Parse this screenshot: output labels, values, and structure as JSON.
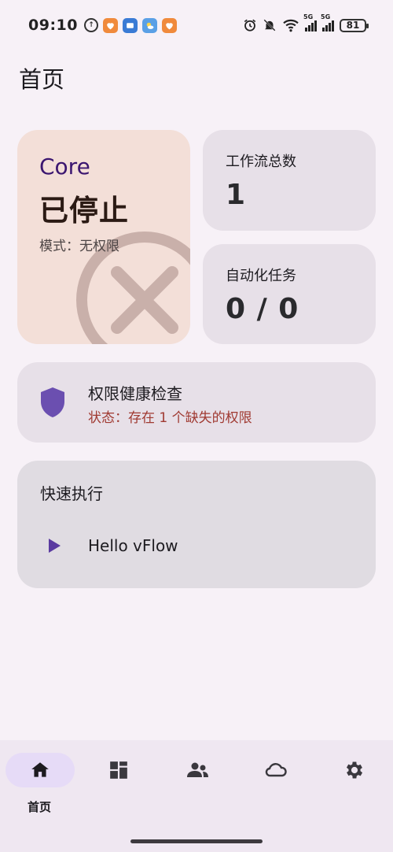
{
  "status_bar": {
    "time": "09:10",
    "signal_1_label": "5G",
    "signal_2_label": "5G",
    "battery": "81"
  },
  "page": {
    "title": "首页"
  },
  "core_card": {
    "label": "Core",
    "status": "已停止",
    "mode": "模式：无权限",
    "icon": "stopped-x-icon",
    "color": "#f3dfd8"
  },
  "stats": {
    "workflows": {
      "label": "工作流总数",
      "value": "1"
    },
    "automation": {
      "label": "自动化任务",
      "value": "0 / 0"
    }
  },
  "permission_check": {
    "title": "权限健康检查",
    "status": "状态：存在 1 个缺失的权限",
    "icon": "shield-icon",
    "status_color": "#a03a32"
  },
  "quick_run": {
    "title": "快速执行",
    "items": [
      {
        "label": "Hello vFlow",
        "icon": "play-icon"
      }
    ]
  },
  "bottom_nav": {
    "items": [
      {
        "icon": "home-icon",
        "label": "首页",
        "active": true
      },
      {
        "icon": "dashboard-icon",
        "active": false
      },
      {
        "icon": "community-icon",
        "active": false
      },
      {
        "icon": "cloud-icon",
        "active": false
      },
      {
        "icon": "settings-icon",
        "active": false
      }
    ]
  },
  "colors": {
    "accent": "#5a3aa0",
    "background": "#f7f1f7"
  }
}
